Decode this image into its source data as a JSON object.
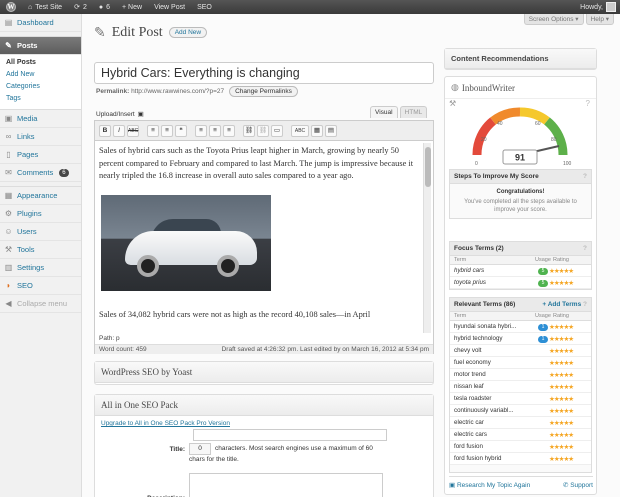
{
  "adminbar": {
    "site": "Test Site",
    "updates": "2",
    "comments": "6",
    "new": "+ New",
    "view_post": "View Post",
    "seo": "SEO",
    "howdy": "Howdy,"
  },
  "sidebar": {
    "items": [
      {
        "label": "Dashboard"
      },
      {
        "label": "Posts"
      },
      {
        "label": "Media"
      },
      {
        "label": "Links"
      },
      {
        "label": "Pages"
      },
      {
        "label": "Comments",
        "badge": "6"
      },
      {
        "label": "Appearance"
      },
      {
        "label": "Plugins"
      },
      {
        "label": "Users"
      },
      {
        "label": "Tools"
      },
      {
        "label": "Settings"
      },
      {
        "label": "SEO"
      },
      {
        "label": "Collapse menu"
      }
    ],
    "submenu": [
      "All Posts",
      "Add New",
      "Categories",
      "Tags"
    ]
  },
  "header": {
    "title": "Edit Post",
    "add_new": "Add New",
    "screen_options": "Screen Options ▾",
    "help": "Help ▾"
  },
  "post": {
    "title": "Hybrid Cars: Everything is changing",
    "permalink_label": "Permalink:",
    "permalink_url": "http://www.rawwines.com/?p=27",
    "change_permalinks": "Change Permalinks",
    "upload_insert": "Upload/Insert",
    "tab_visual": "Visual",
    "tab_html": "HTML",
    "paragraph1": "Sales of hybrid cars such as the Toyota Prius leapt higher in March, growing by nearly 50 percent compared to February and compared to last March. The jump is impressive because it nearly tripled the 16.8 increase in overall auto sales compared to a year ago.",
    "paragraph2": "Sales of 34,082 hybrid cars were not as high as the record 40,108 sales—in April",
    "path": "Path: p",
    "word_count": "Word count: 459",
    "draft_status": "Draft saved at 4:26:32 pm. Last edited by on March 16, 2012 at 5:34 pm"
  },
  "toolbar": [
    "B",
    "I",
    "ABC",
    "≡",
    "≡",
    "❝",
    "≡",
    "≡",
    "≡",
    "⛓",
    "⛓",
    "▭",
    "ABC",
    "▦"
  ],
  "yoast": {
    "title": "WordPress SEO by Yoast"
  },
  "aioseo": {
    "title": "All in One SEO Pack",
    "upgrade": "Upgrade to All in One SEO Pack Pro Version",
    "title_label": "Title:",
    "title_count": "0",
    "title_help": "characters. Most search engines use a maximum of 60 chars for the title.",
    "description_label": "Description:"
  },
  "content_recs": {
    "title": "Content Recommendations"
  },
  "inboundwriter": {
    "title": "InboundWriter",
    "score": "91",
    "gauge_ticks": [
      "20",
      "40",
      "60",
      "80",
      "100",
      "0"
    ],
    "steps_title": "Steps To Improve My Score",
    "congrats_title": "Congratulations!",
    "congrats_text": "You've completed all the steps available to improve your score.",
    "focus_title": "Focus Terms (2)",
    "col_term": "Term",
    "col_usage": "Usage",
    "col_rating": "Rating",
    "focus_terms": [
      {
        "term": "hybrid cars",
        "usage": "5"
      },
      {
        "term": "toyota prius",
        "usage": "5"
      }
    ],
    "relevant_title": "Relevant Terms (86)",
    "add_terms": "+ Add Terms",
    "relevant_terms": [
      {
        "term": "hyundai sonata hybri...",
        "usage": "1"
      },
      {
        "term": "hybrid technology",
        "usage": "1"
      },
      {
        "term": "chevy volt",
        "usage": ""
      },
      {
        "term": "fuel economy",
        "usage": ""
      },
      {
        "term": "motor trend",
        "usage": ""
      },
      {
        "term": "nissan leaf",
        "usage": ""
      },
      {
        "term": "tesla roadster",
        "usage": ""
      },
      {
        "term": "continuously variabl...",
        "usage": ""
      },
      {
        "term": "electric car",
        "usage": ""
      },
      {
        "term": "electric cars",
        "usage": ""
      },
      {
        "term": "ford fusion",
        "usage": ""
      },
      {
        "term": "ford fusion hybrid",
        "usage": ""
      }
    ],
    "research": "Research My Topic Again",
    "support": "Support"
  }
}
